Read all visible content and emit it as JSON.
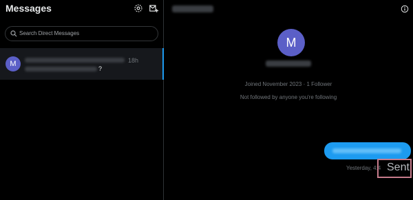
{
  "sidebar": {
    "title": "Messages",
    "icons": {
      "settings": "gear-icon",
      "new_message": "new-message-icon"
    },
    "search": {
      "placeholder": "Search Direct Messages",
      "icon": "search-icon"
    },
    "conversations": [
      {
        "avatar_initial": "M",
        "time": "18h",
        "preview_suffix": "?"
      }
    ]
  },
  "chat": {
    "info_icon": "info-icon",
    "profile": {
      "avatar_initial": "M",
      "joined": "Joined November 2023 · 1 Follower",
      "followed_note": "Not followed by anyone you're following"
    },
    "message": {
      "timestamp": "Yesterday, 4:4",
      "status": "Sent"
    }
  },
  "colors": {
    "accent": "#1d9bf0",
    "avatar": "#5b5fc7",
    "highlight_box": "#c77c8c"
  }
}
